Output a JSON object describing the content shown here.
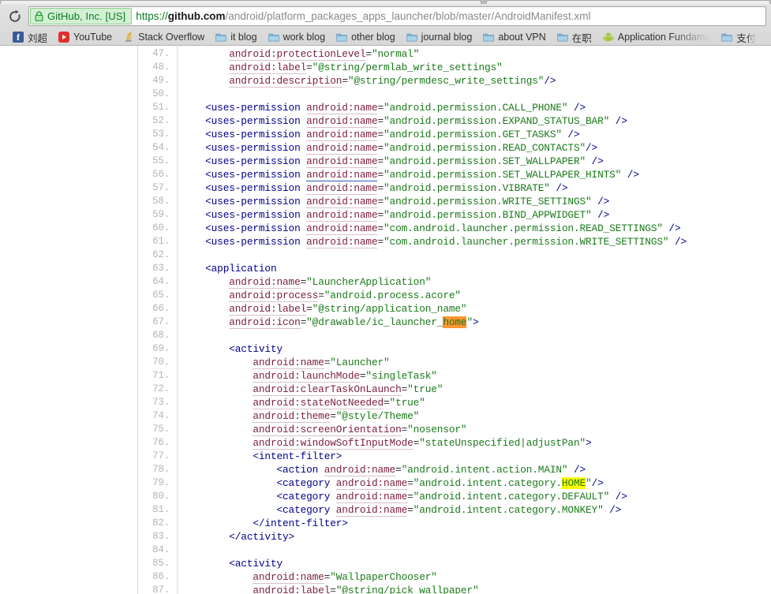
{
  "browser": {
    "reload_icon": "reload-icon",
    "omnibox": {
      "ev_badge_label": "GitHub, Inc. [US]",
      "lock_icon": "lock-icon",
      "url_scheme": "https://",
      "url_host": "github.com",
      "url_path": "/android/platform_packages_apps_launcher/blob/master/AndroidManifest.xml",
      "url_full": "https://github.com/android/platform_packages_apps_launcher/blob/master/AndroidManifest.xml"
    },
    "bookmarks": [
      {
        "label": "刘超",
        "icon": "facebook-icon",
        "faded": false
      },
      {
        "label": "YouTube",
        "icon": "youtube-icon",
        "faded": false
      },
      {
        "label": "Stack Overflow",
        "icon": "stackoverflow-icon",
        "faded": false
      },
      {
        "label": "it blog",
        "icon": "folder-icon",
        "faded": false
      },
      {
        "label": "work blog",
        "icon": "folder-icon",
        "faded": false
      },
      {
        "label": "other blog",
        "icon": "folder-icon",
        "faded": false
      },
      {
        "label": "journal blog",
        "icon": "folder-icon",
        "faded": false
      },
      {
        "label": "about VPN",
        "icon": "folder-icon",
        "faded": false
      },
      {
        "label": "在职",
        "icon": "folder-icon",
        "faded": false
      },
      {
        "label": "Application Fundame",
        "icon": "android-icon",
        "faded": true
      },
      {
        "label": "支付",
        "icon": "folder-icon",
        "faded": true
      }
    ]
  },
  "code_view": {
    "first_line": 47,
    "last_line": 87,
    "lines": [
      {
        "n": 47,
        "tokens": [
          {
            "t": "plain",
            "v": "        "
          },
          {
            "t": "attr",
            "v": "android:protectionLevel"
          },
          {
            "t": "punc",
            "v": "="
          },
          {
            "t": "val",
            "v": "\"normal\""
          }
        ]
      },
      {
        "n": 48,
        "tokens": [
          {
            "t": "plain",
            "v": "        "
          },
          {
            "t": "attr",
            "v": "android:label"
          },
          {
            "t": "punc",
            "v": "="
          },
          {
            "t": "val",
            "v": "\"@string/permlab_write_settings\""
          }
        ]
      },
      {
        "n": 49,
        "tokens": [
          {
            "t": "plain",
            "v": "        "
          },
          {
            "t": "attr",
            "v": "android:description"
          },
          {
            "t": "punc",
            "v": "="
          },
          {
            "t": "val",
            "v": "\"@string/permdesc_write_settings\""
          },
          {
            "t": "tag",
            "v": "/>"
          }
        ]
      },
      {
        "n": 50,
        "tokens": []
      },
      {
        "n": 51,
        "tokens": [
          {
            "t": "plain",
            "v": "    "
          },
          {
            "t": "tag",
            "v": "<uses-permission "
          },
          {
            "t": "attr",
            "v": "android:name"
          },
          {
            "t": "punc",
            "v": "="
          },
          {
            "t": "val",
            "v": "\"android.permission.CALL_PHONE\""
          },
          {
            "t": "tag",
            "v": " />"
          }
        ]
      },
      {
        "n": 52,
        "tokens": [
          {
            "t": "plain",
            "v": "    "
          },
          {
            "t": "tag",
            "v": "<uses-permission "
          },
          {
            "t": "attr",
            "v": "android:name"
          },
          {
            "t": "punc",
            "v": "="
          },
          {
            "t": "val",
            "v": "\"android.permission.EXPAND_STATUS_BAR\""
          },
          {
            "t": "tag",
            "v": " />"
          }
        ]
      },
      {
        "n": 53,
        "tokens": [
          {
            "t": "plain",
            "v": "    "
          },
          {
            "t": "tag",
            "v": "<uses-permission "
          },
          {
            "t": "attr",
            "v": "android:name"
          },
          {
            "t": "punc",
            "v": "="
          },
          {
            "t": "val",
            "v": "\"android.permission.GET_TASKS\""
          },
          {
            "t": "tag",
            "v": " />"
          }
        ]
      },
      {
        "n": 54,
        "tokens": [
          {
            "t": "plain",
            "v": "    "
          },
          {
            "t": "tag",
            "v": "<uses-permission "
          },
          {
            "t": "attr",
            "v": "android:name"
          },
          {
            "t": "punc",
            "v": "="
          },
          {
            "t": "val",
            "v": "\"android.permission.READ_CONTACTS\""
          },
          {
            "t": "tag",
            "v": "/>"
          }
        ]
      },
      {
        "n": 55,
        "tokens": [
          {
            "t": "plain",
            "v": "    "
          },
          {
            "t": "tag",
            "v": "<uses-permission "
          },
          {
            "t": "attr",
            "v": "android:name"
          },
          {
            "t": "punc",
            "v": "="
          },
          {
            "t": "val",
            "v": "\"android.permission.SET_WALLPAPER\""
          },
          {
            "t": "tag",
            "v": " />"
          }
        ]
      },
      {
        "n": 56,
        "tokens": [
          {
            "t": "plain",
            "v": "    "
          },
          {
            "t": "tag",
            "v": "<uses-permission "
          },
          {
            "t": "attr-hover",
            "v": "android:name"
          },
          {
            "t": "punc",
            "v": "="
          },
          {
            "t": "val",
            "v": "\"android.permission.SET_WALLPAPER_HINTS\""
          },
          {
            "t": "tag",
            "v": " />"
          }
        ]
      },
      {
        "n": 57,
        "tokens": [
          {
            "t": "plain",
            "v": "    "
          },
          {
            "t": "tag",
            "v": "<uses-permission "
          },
          {
            "t": "attr",
            "v": "android:name"
          },
          {
            "t": "punc",
            "v": "="
          },
          {
            "t": "val",
            "v": "\"android.permission.VIBRATE\""
          },
          {
            "t": "tag",
            "v": " />"
          }
        ]
      },
      {
        "n": 58,
        "tokens": [
          {
            "t": "plain",
            "v": "    "
          },
          {
            "t": "tag",
            "v": "<uses-permission "
          },
          {
            "t": "attr",
            "v": "android:name"
          },
          {
            "t": "punc",
            "v": "="
          },
          {
            "t": "val",
            "v": "\"android.permission.WRITE_SETTINGS\""
          },
          {
            "t": "tag",
            "v": " />"
          }
        ]
      },
      {
        "n": 59,
        "tokens": [
          {
            "t": "plain",
            "v": "    "
          },
          {
            "t": "tag",
            "v": "<uses-permission "
          },
          {
            "t": "attr",
            "v": "android:name"
          },
          {
            "t": "punc",
            "v": "="
          },
          {
            "t": "val",
            "v": "\"android.permission.BIND_APPWIDGET\""
          },
          {
            "t": "tag",
            "v": " />"
          }
        ]
      },
      {
        "n": 60,
        "tokens": [
          {
            "t": "plain",
            "v": "    "
          },
          {
            "t": "tag",
            "v": "<uses-permission "
          },
          {
            "t": "attr",
            "v": "android:name"
          },
          {
            "t": "punc",
            "v": "="
          },
          {
            "t": "val",
            "v": "\"com.android.launcher.permission.READ_SETTINGS\""
          },
          {
            "t": "tag",
            "v": " />"
          }
        ]
      },
      {
        "n": 61,
        "tokens": [
          {
            "t": "plain",
            "v": "    "
          },
          {
            "t": "tag",
            "v": "<uses-permission "
          },
          {
            "t": "attr",
            "v": "android:name"
          },
          {
            "t": "punc",
            "v": "="
          },
          {
            "t": "val",
            "v": "\"com.android.launcher.permission.WRITE_SETTINGS\""
          },
          {
            "t": "tag",
            "v": " />"
          }
        ]
      },
      {
        "n": 62,
        "tokens": []
      },
      {
        "n": 63,
        "tokens": [
          {
            "t": "plain",
            "v": "    "
          },
          {
            "t": "tag",
            "v": "<application"
          }
        ]
      },
      {
        "n": 64,
        "tokens": [
          {
            "t": "plain",
            "v": "        "
          },
          {
            "t": "attr",
            "v": "android:name"
          },
          {
            "t": "punc",
            "v": "="
          },
          {
            "t": "val",
            "v": "\"LauncherApplication\""
          }
        ]
      },
      {
        "n": 65,
        "tokens": [
          {
            "t": "plain",
            "v": "        "
          },
          {
            "t": "attr",
            "v": "android:process"
          },
          {
            "t": "punc",
            "v": "="
          },
          {
            "t": "val",
            "v": "\"android.process.acore\""
          }
        ]
      },
      {
        "n": 66,
        "tokens": [
          {
            "t": "plain",
            "v": "        "
          },
          {
            "t": "attr",
            "v": "android:label"
          },
          {
            "t": "punc",
            "v": "="
          },
          {
            "t": "val",
            "v": "\"@string/application_name\""
          }
        ]
      },
      {
        "n": 67,
        "tokens": [
          {
            "t": "plain",
            "v": "        "
          },
          {
            "t": "attr",
            "v": "android:icon"
          },
          {
            "t": "punc",
            "v": "="
          },
          {
            "t": "val",
            "v": "\"@drawable/ic_launcher_"
          },
          {
            "t": "hl-orange",
            "v": "home"
          },
          {
            "t": "val",
            "v": "\""
          },
          {
            "t": "tag",
            "v": ">"
          }
        ]
      },
      {
        "n": 68,
        "tokens": []
      },
      {
        "n": 69,
        "tokens": [
          {
            "t": "plain",
            "v": "        "
          },
          {
            "t": "tag",
            "v": "<activity"
          }
        ]
      },
      {
        "n": 70,
        "tokens": [
          {
            "t": "plain",
            "v": "            "
          },
          {
            "t": "attr",
            "v": "android:name"
          },
          {
            "t": "punc",
            "v": "="
          },
          {
            "t": "val",
            "v": "\"Launcher\""
          }
        ]
      },
      {
        "n": 71,
        "tokens": [
          {
            "t": "plain",
            "v": "            "
          },
          {
            "t": "attr",
            "v": "android:launchMode"
          },
          {
            "t": "punc",
            "v": "="
          },
          {
            "t": "val",
            "v": "\"singleTask\""
          }
        ]
      },
      {
        "n": 72,
        "tokens": [
          {
            "t": "plain",
            "v": "            "
          },
          {
            "t": "attr",
            "v": "android:clearTaskOnLaunch"
          },
          {
            "t": "punc",
            "v": "="
          },
          {
            "t": "val",
            "v": "\"true\""
          }
        ]
      },
      {
        "n": 73,
        "tokens": [
          {
            "t": "plain",
            "v": "            "
          },
          {
            "t": "attr",
            "v": "android:stateNotNeeded"
          },
          {
            "t": "punc",
            "v": "="
          },
          {
            "t": "val",
            "v": "\"true\""
          }
        ]
      },
      {
        "n": 74,
        "tokens": [
          {
            "t": "plain",
            "v": "            "
          },
          {
            "t": "attr",
            "v": "android:theme"
          },
          {
            "t": "punc",
            "v": "="
          },
          {
            "t": "val",
            "v": "\"@style/Theme\""
          }
        ]
      },
      {
        "n": 75,
        "tokens": [
          {
            "t": "plain",
            "v": "            "
          },
          {
            "t": "attr",
            "v": "android:screenOrientation"
          },
          {
            "t": "punc",
            "v": "="
          },
          {
            "t": "val",
            "v": "\"nosensor\""
          }
        ]
      },
      {
        "n": 76,
        "tokens": [
          {
            "t": "plain",
            "v": "            "
          },
          {
            "t": "attr",
            "v": "android:windowSoftInputMode"
          },
          {
            "t": "punc",
            "v": "="
          },
          {
            "t": "val",
            "v": "\"stateUnspecified|adjustPan\""
          },
          {
            "t": "tag",
            "v": ">"
          }
        ]
      },
      {
        "n": 77,
        "tokens": [
          {
            "t": "plain",
            "v": "            "
          },
          {
            "t": "tag",
            "v": "<intent-filter>"
          }
        ]
      },
      {
        "n": 78,
        "tokens": [
          {
            "t": "plain",
            "v": "                "
          },
          {
            "t": "tag",
            "v": "<action "
          },
          {
            "t": "attr",
            "v": "android:name"
          },
          {
            "t": "punc",
            "v": "="
          },
          {
            "t": "val",
            "v": "\"android.intent.action.MAIN\""
          },
          {
            "t": "tag",
            "v": " />"
          }
        ]
      },
      {
        "n": 79,
        "tokens": [
          {
            "t": "plain",
            "v": "                "
          },
          {
            "t": "tag",
            "v": "<category "
          },
          {
            "t": "attr",
            "v": "android:name"
          },
          {
            "t": "punc",
            "v": "="
          },
          {
            "t": "val",
            "v": "\"android.intent.category."
          },
          {
            "t": "hl-yellow",
            "v": "HOME"
          },
          {
            "t": "val",
            "v": "\""
          },
          {
            "t": "tag",
            "v": "/>"
          }
        ]
      },
      {
        "n": 80,
        "tokens": [
          {
            "t": "plain",
            "v": "                "
          },
          {
            "t": "tag",
            "v": "<category "
          },
          {
            "t": "attr",
            "v": "android:name"
          },
          {
            "t": "punc",
            "v": "="
          },
          {
            "t": "val",
            "v": "\"android.intent.category.DEFAULT\""
          },
          {
            "t": "tag",
            "v": " />"
          }
        ]
      },
      {
        "n": 81,
        "tokens": [
          {
            "t": "plain",
            "v": "                "
          },
          {
            "t": "tag",
            "v": "<category "
          },
          {
            "t": "attr",
            "v": "android:name"
          },
          {
            "t": "punc",
            "v": "="
          },
          {
            "t": "val",
            "v": "\"android.intent.category.MONKEY\""
          },
          {
            "t": "tag",
            "v": " />"
          }
        ]
      },
      {
        "n": 82,
        "tokens": [
          {
            "t": "plain",
            "v": "            "
          },
          {
            "t": "tag",
            "v": "</intent-filter>"
          }
        ]
      },
      {
        "n": 83,
        "tokens": [
          {
            "t": "plain",
            "v": "        "
          },
          {
            "t": "tag",
            "v": "</activity>"
          }
        ]
      },
      {
        "n": 84,
        "tokens": []
      },
      {
        "n": 85,
        "tokens": [
          {
            "t": "plain",
            "v": "        "
          },
          {
            "t": "tag",
            "v": "<activity"
          }
        ]
      },
      {
        "n": 86,
        "tokens": [
          {
            "t": "plain",
            "v": "            "
          },
          {
            "t": "attr",
            "v": "android:name"
          },
          {
            "t": "punc",
            "v": "="
          },
          {
            "t": "val",
            "v": "\"WallpaperChooser\""
          }
        ]
      },
      {
        "n": 87,
        "tokens": [
          {
            "t": "plain",
            "v": "            "
          },
          {
            "t": "attr",
            "v": "android:label"
          },
          {
            "t": "punc",
            "v": "="
          },
          {
            "t": "val",
            "v": "\"@string/pick_wallpaper\""
          }
        ]
      }
    ],
    "search_highlights": [
      {
        "line": 67,
        "text": "home",
        "color": "#ff9632",
        "active": true
      },
      {
        "line": 79,
        "text": "HOME",
        "color": "#ffff00",
        "active": false
      }
    ]
  }
}
